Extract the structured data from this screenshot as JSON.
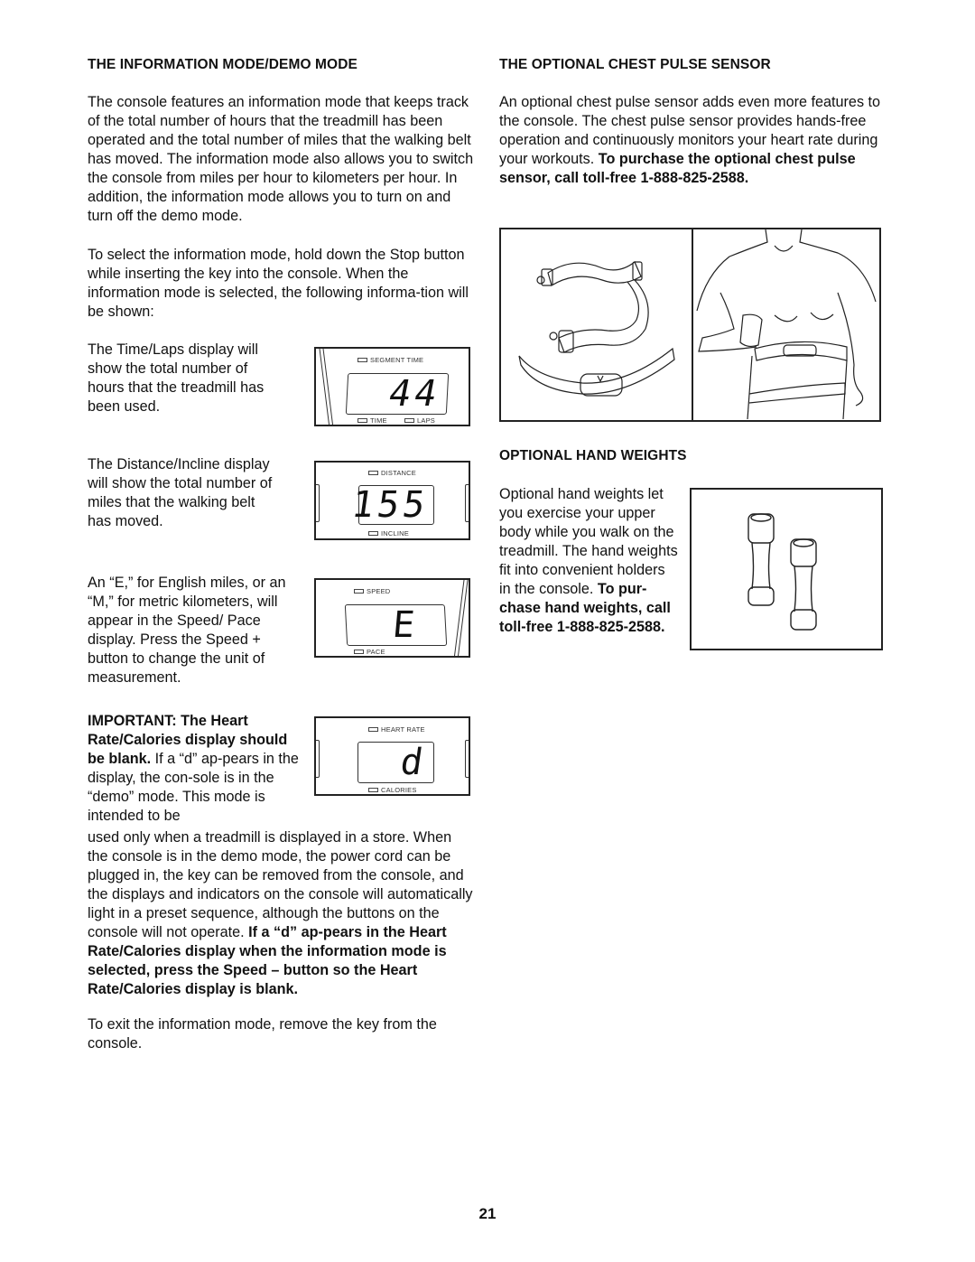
{
  "left": {
    "heading": "THE INFORMATION MODE/DEMO MODE",
    "intro": "The console features an information mode that keeps track of the total number of hours that the treadmill has been operated and the total number of miles that the walking belt has moved. The information mode also allows you to switch the console from miles per hour to kilometers per hour. In addition, the information mode allows you to turn on and turn off the demo mode.",
    "select": "To select the information mode, hold down the Stop button while inserting the key into the console. When the information mode is selected, the following informa-tion will be shown:",
    "time_text": "The Time/Laps display will show the total number of hours that the treadmill has been used.",
    "distance_text": "The Distance/Incline display will show the total number of miles that the walking belt has moved.",
    "unit_text": "An “E,” for English miles, or an “M,” for metric kilometers, will appear in the Speed/ Pace display. Press the Speed + button to change the unit of measurement.",
    "important_bold": "IMPORTANT: The Heart Rate/Calories display should be blank.",
    "important_rest": " If a “d” ap-pears in the display, the con-sole is in the “demo” mode. This mode is intended to be",
    "demo_text": "used only when a treadmill is displayed in a store. When the console is in the demo mode, the power cord can be plugged in, the key can be removed from the console, and the displays and indicators on the console will automatically light in a preset sequence, although the buttons on the console will not operate.",
    "demo_bold": " If a “d” ap-pears in the Heart Rate/Calories display when the information mode is selected, press the Speed – button so the Heart Rate/Calories display is blank.",
    "exit_text": "To exit the information mode, remove the key from the console."
  },
  "displays": {
    "time": {
      "top_label": "SEGMENT TIME",
      "value": "44",
      "bottom_labels": [
        "TIME",
        "LAPS"
      ]
    },
    "distance": {
      "top_label": "DISTANCE",
      "value": "155",
      "bottom_label": "INCLINE"
    },
    "speed": {
      "top_label": "SPEED",
      "value": "E",
      "bottom_label": "PACE"
    },
    "heart": {
      "top_label": "HEART RATE",
      "value": "d",
      "bottom_label": "CALORIES"
    }
  },
  "right": {
    "chest_heading": "THE OPTIONAL CHEST PULSE SENSOR",
    "chest_text": "An optional chest pulse sensor adds even more features to the console. The chest pulse sensor provides hands-free operation and continuously monitors your heart rate during your workouts.",
    "chest_bold": " To purchase the optional chest pulse sensor, call toll-free 1-888-825-2588.",
    "weights_heading": "OPTIONAL HAND WEIGHTS",
    "weights_text": "Optional hand weights let you exercise your upper body while you walk on the treadmill. The hand weights fit into convenient holders in the console.",
    "weights_bold": " To pur-chase hand weights, call toll-free 1-888-825-2588."
  },
  "page_number": "21"
}
